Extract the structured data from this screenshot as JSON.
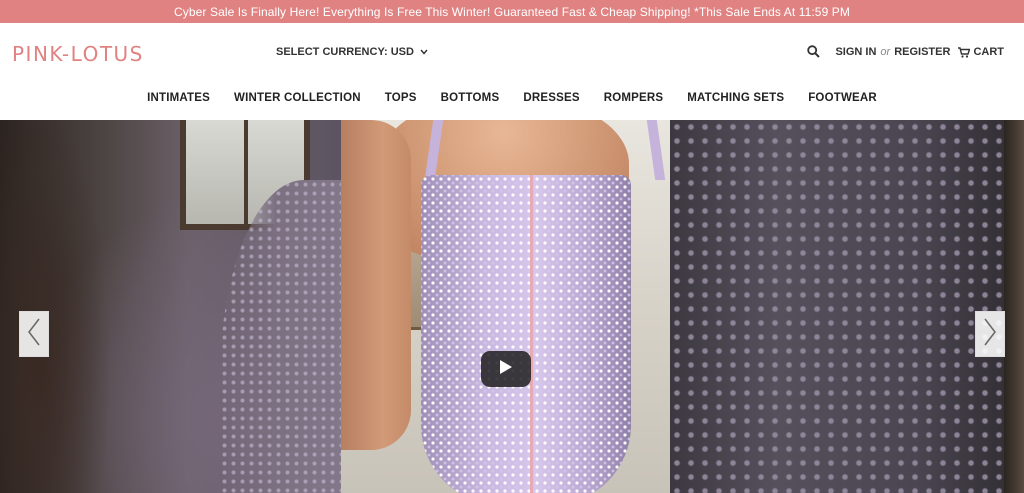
{
  "promo": {
    "text": "Cyber Sale Is Finally Here! Everything Is Free This Winter! Guaranteed Fast & Cheap Shipping! *This Sale Ends At 11:59 PM",
    "background": "#e08282"
  },
  "header": {
    "logo": "PINK-LOTUS",
    "currency_label": "SELECT CURRENCY: USD",
    "account": {
      "sign_in": "SIGN IN",
      "or": "or",
      "register": "REGISTER",
      "cart": "CART"
    }
  },
  "nav": {
    "items": [
      "INTIMATES",
      "WINTER COLLECTION",
      "TOPS",
      "BOTTOMS",
      "DRESSES",
      "ROMPERS",
      "MATCHING SETS",
      "FOOTWEAR"
    ]
  },
  "hero": {
    "icons": {
      "play": "play-icon",
      "prev": "chevron-left-icon",
      "next": "chevron-right-icon"
    }
  },
  "colors": {
    "brand": "#e08282",
    "text": "#222222"
  }
}
